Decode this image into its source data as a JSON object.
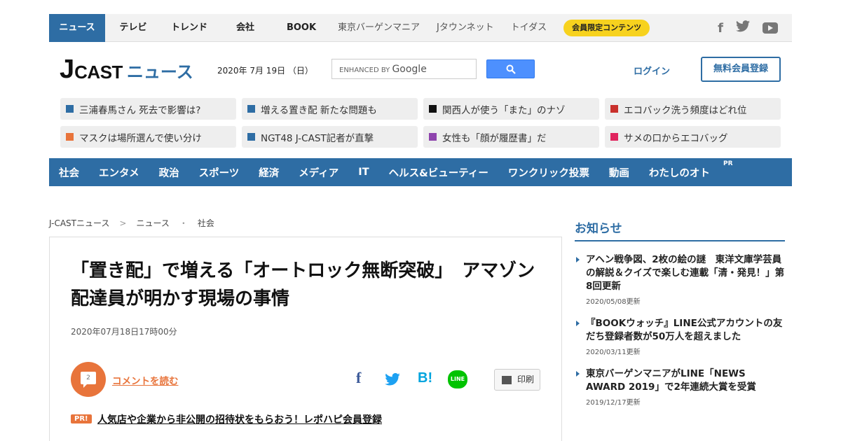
{
  "topnav": {
    "items": [
      "ニュース",
      "テレビ",
      "トレンド",
      "会社",
      "BOOK"
    ],
    "sub_items": [
      "東京バーゲンマニア",
      "Jタウンネット",
      "トイダス"
    ],
    "member": "会員限定コンテンツ",
    "social": [
      "facebook-icon",
      "twitter-icon",
      "youtube-icon"
    ]
  },
  "header": {
    "logo_j": "J",
    "logo_cast": "CAST",
    "logo_news": "ニュース",
    "date": "2020年 7月 19日 （日）",
    "search_enhanced": "ENHANCED BY",
    "search_google": "Google",
    "login": "ログイン",
    "signup": "無料会員登録"
  },
  "topics": [
    {
      "label": "三浦春馬さん 死去で影響は?",
      "color": "#2e6da4"
    },
    {
      "label": "増える置き配 新たな問題も",
      "color": "#2e6da4"
    },
    {
      "label": "関西人が使う「また」のナゾ",
      "color": "#111111"
    },
    {
      "label": "エコバック洗う頻度はどれ位",
      "color": "#c9302c"
    },
    {
      "label": "マスクは場所選んで使い分け",
      "color": "#e8743b"
    },
    {
      "label": "NGT48 J-CAST記者が直撃",
      "color": "#2e6da4"
    },
    {
      "label": "女性も「顔が履歴書」だ",
      "color": "#8e44ad"
    },
    {
      "label": "サメの口からエコバッグ",
      "color": "#e0245e"
    }
  ],
  "catnav": {
    "items": [
      "社会",
      "エンタメ",
      "政治",
      "スポーツ",
      "経済",
      "メディア",
      "IT",
      "ヘルス&ビューティー",
      "ワンクリック投票",
      "動画",
      "わたしのオト"
    ],
    "pr": "PR"
  },
  "breadcrumb": [
    "J-CASTニュース",
    "ニュース",
    "社会"
  ],
  "breadcrumb_seps": [
    ">",
    "・"
  ],
  "article": {
    "headline": "「置き配」で増える「オートロック無断突破」　アマゾン配達員が明かす現場の事情",
    "date": "2020年07月18日17時00分",
    "comment_count": "2",
    "comment_label": "コメントを読む",
    "line_label": "LINE",
    "hatena_label": "B!",
    "fb_label": "f",
    "print_label": "印刷",
    "pr_badge": "PR!",
    "pr_text": "人気店や企業から非公開の招待状をもらおう！レポハピ会員登録"
  },
  "sidebar": {
    "title": "お知らせ",
    "items": [
      {
        "title": "アヘン戦争図、2枚の絵の謎　東洋文庫学芸員の解説＆クイズで楽しむ連載「清・発見！」第8回更新",
        "date": "2020/05/08更新"
      },
      {
        "title": "『BOOKウォッチ』LINE公式アカウントの友だち登録者数が50万人を超えました",
        "date": "2020/03/11更新"
      },
      {
        "title": "東京バーゲンマニアがLINE「NEWS AWARD 2019」で2年連続大賞を受賞",
        "date": "2019/12/17更新"
      }
    ]
  }
}
